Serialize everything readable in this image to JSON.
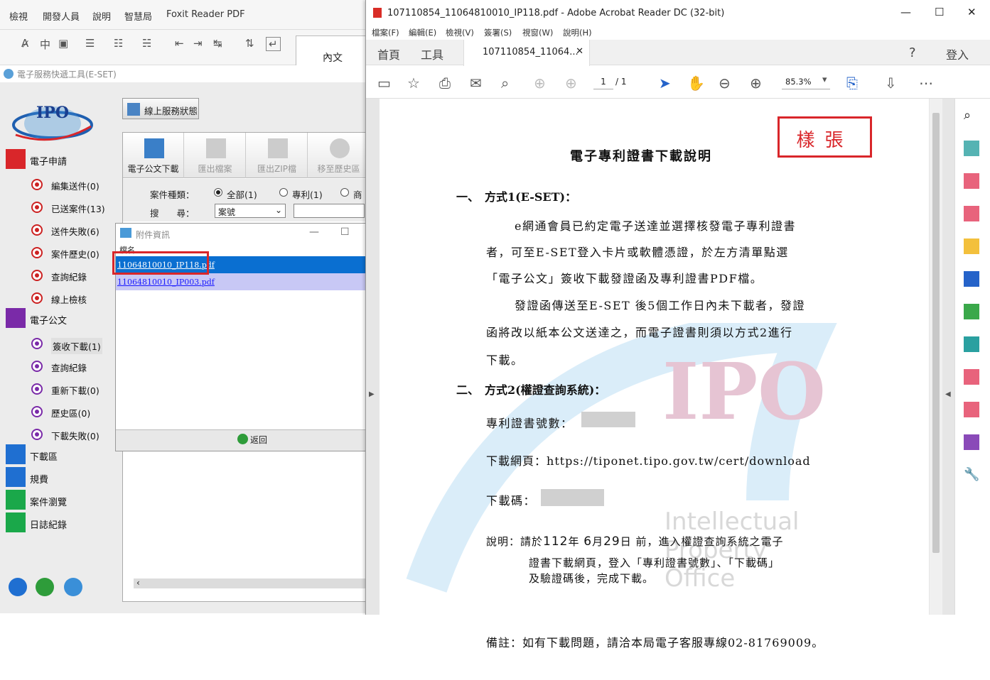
{
  "foxit": {
    "menu": [
      "檢視",
      "開發人員",
      "說明",
      "智慧局",
      "Foxit Reader PDF"
    ],
    "content_tab": "內文"
  },
  "eset": {
    "title": "電子服務快遞工具(E-SET)",
    "status_button": "線上服務狀態",
    "sections": [
      {
        "label": "電子申請",
        "color": "#d9262a",
        "items": [
          "編集送件(0)",
          "已送案件(13)",
          "送件失敗(6)",
          "案件歷史(0)",
          "查詢紀錄",
          "線上檢核"
        ]
      },
      {
        "label": "電子公文",
        "color": "#7a2aa8",
        "items": [
          "簽收下載(1)",
          "查詢紀錄",
          "重新下載(0)",
          "歷史區(0)",
          "下載失敗(0)"
        ]
      }
    ],
    "extra_nav": [
      {
        "label": "下載區",
        "color": "#1f6fd1"
      },
      {
        "label": "規費",
        "color": "#1f6fd1"
      },
      {
        "label": "案件瀏覽",
        "color": "#1aa84a"
      },
      {
        "label": "日誌紀錄",
        "color": "#1aa84a"
      }
    ],
    "toolbar": [
      "電子公文下載",
      "匯出檔案",
      "匯出ZIP檔",
      "移至歷史區"
    ],
    "filter": {
      "type_label": "案件種類：",
      "options": [
        "全部(1)",
        "專利(1)",
        "商標"
      ],
      "search_label": "搜　　尋：",
      "search_field": "案號"
    }
  },
  "attach_dialog": {
    "title": "附件資訊",
    "column": "檔名",
    "files": [
      "11064810010_IP118.pdf",
      "11064810010_IP003.pdf"
    ],
    "back": "返回"
  },
  "acrobat": {
    "title": "107110854_11064810010_IP118.pdf - Adobe Acrobat Reader DC (32-bit)",
    "menu": [
      "檔案(F)",
      "編輯(E)",
      "檢視(V)",
      "簽署(S)",
      "視窗(W)",
      "說明(H)"
    ],
    "tabs": [
      "首頁",
      "工具"
    ],
    "doc_tab": "107110854_11064...",
    "login": "登入",
    "page_current": "1",
    "page_total": "/ 1",
    "zoom": "85.3%"
  },
  "pdf": {
    "stamp": "樣張",
    "title": "電子專利證書下載說明",
    "s1_head": "一、　方式1(E-SET)：",
    "s1_lines": [
      "e網通會員已約定電子送達並選擇核發電子專利證書",
      "者，可至E-SET登入卡片或軟體憑證，於左方清單點選",
      "「電子公文」簽收下載發證函及專利證書PDF檔。",
      "發證函傳送至E-SET 後5個工作日內未下載者，發證",
      "函將改以紙本公文送達之，而電子證書則須以方式2進行",
      "下載。"
    ],
    "s2_head": "二、　方式2(權證查詢系統)：",
    "cert_no_label": "專利證書號數：",
    "url_label": "下載網頁：",
    "url": "https://tiponet.tipo.gov.tw/cert/download",
    "code_label": "下載碼：",
    "note_prefix": "說明：請於",
    "note_year": "112",
    "note_y": "年",
    "note_month": "6",
    "note_m": "月",
    "note_day": "29",
    "note_d": "日",
    "note_rest": "前，進入權證查詢系統之電子",
    "note_line2": "證書下載網頁，登入「專利證書號數」、「下載碼」",
    "note_line3": "及驗證碼後，完成下載。",
    "remark": "備註：如有下載問題，請洽本局電子客服專線02-81769009。",
    "watermark_lines": [
      "Intellectual",
      "Property",
      "Office"
    ],
    "watermark_logo": "IPO"
  }
}
